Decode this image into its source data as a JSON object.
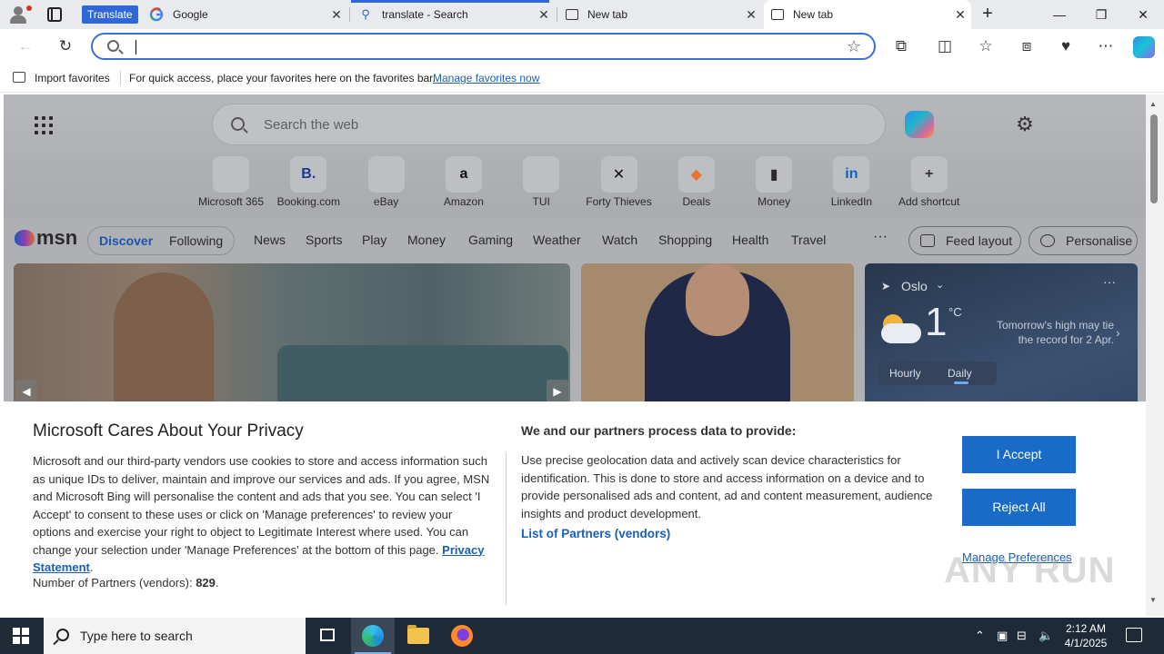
{
  "browser": {
    "translate_badge": "Translate",
    "tabs": [
      {
        "title": "Google",
        "active": false
      },
      {
        "title": "translate - Search",
        "active": false
      },
      {
        "title": "New tab",
        "active": false
      },
      {
        "title": "New tab",
        "active": true
      }
    ],
    "tab_close": "✕",
    "new_tab": "+",
    "window_controls": {
      "minimize": "—",
      "restore": "❐",
      "close": "✕"
    },
    "address_value": ""
  },
  "favbar": {
    "import_label": "Import favorites",
    "info_text": "For quick access, place your favorites here on the favorites bar.",
    "manage_link": "Manage favorites now"
  },
  "newtab": {
    "search_placeholder": "Search the web",
    "shortcuts": [
      {
        "label": "Microsoft 365",
        "glyph": "",
        "color": "#7b5bd6"
      },
      {
        "label": "Booking.com",
        "glyph": "B.",
        "color": "#1b3a8a"
      },
      {
        "label": "eBay",
        "glyph": "",
        "color": "#e53238"
      },
      {
        "label": "Amazon",
        "glyph": "a",
        "color": "#111111"
      },
      {
        "label": "TUI",
        "glyph": "",
        "color": "#2a7fd6"
      },
      {
        "label": "Forty Thieves",
        "glyph": "✕",
        "color": "#111111"
      },
      {
        "label": "Deals",
        "glyph": "◆",
        "color": "#e8742e"
      },
      {
        "label": "Money",
        "glyph": "▮",
        "color": "#2a2a2a"
      },
      {
        "label": "LinkedIn",
        "glyph": "in",
        "color": "#0a66c2"
      },
      {
        "label": "Add shortcut",
        "glyph": "+",
        "color": "#333333"
      }
    ]
  },
  "msn": {
    "logo": "msn",
    "toggle": [
      "Discover",
      "Following"
    ],
    "nav": [
      "News",
      "Sports",
      "Play",
      "Money",
      "Gaming",
      "Weather",
      "Watch",
      "Shopping",
      "Health",
      "Travel"
    ],
    "more": "···",
    "feed_layout": "Feed layout",
    "personalise": "Personalise"
  },
  "weather": {
    "location": "Oslo",
    "temperature": "1",
    "unit": "°C",
    "note": "Tomorrow's high may tie the record for 2 Apr.",
    "tabs": [
      "Hourly",
      "Daily"
    ],
    "active_tab": "Daily"
  },
  "privacy": {
    "title": "Microsoft Cares About Your Privacy",
    "body": "Microsoft and our third-party vendors use cookies to store and access information such as unique IDs to deliver, maintain and improve our services and ads. If you agree, MSN and Microsoft Bing will personalise the content and ads that you see. You can select 'I Accept' to consent to these uses or click on 'Manage preferences' to review your options and exercise your right to object to Legitimate Interest where used.  You can change your selection under 'Manage Preferences' at the bottom of this page.",
    "privacy_link": "Privacy Statement",
    "partners_label": "Number of Partners (vendors):",
    "partners_count": "829",
    "process_heading": "We and our partners process data to provide:",
    "process_body": "Use precise geolocation data and actively scan device characteristics for identification. This is done to store and access information on a device and to provide personalised ads and content, ad and content measurement, audience insights and product development.",
    "vendors_link": "List of Partners (vendors)",
    "accept": "I Accept",
    "reject": "Reject All",
    "manage": "Manage Preferences"
  },
  "watermark": "ANY RUN",
  "taskbar": {
    "search_placeholder": "Type here to search",
    "time": "2:12 AM",
    "date": "4/1/2025"
  }
}
